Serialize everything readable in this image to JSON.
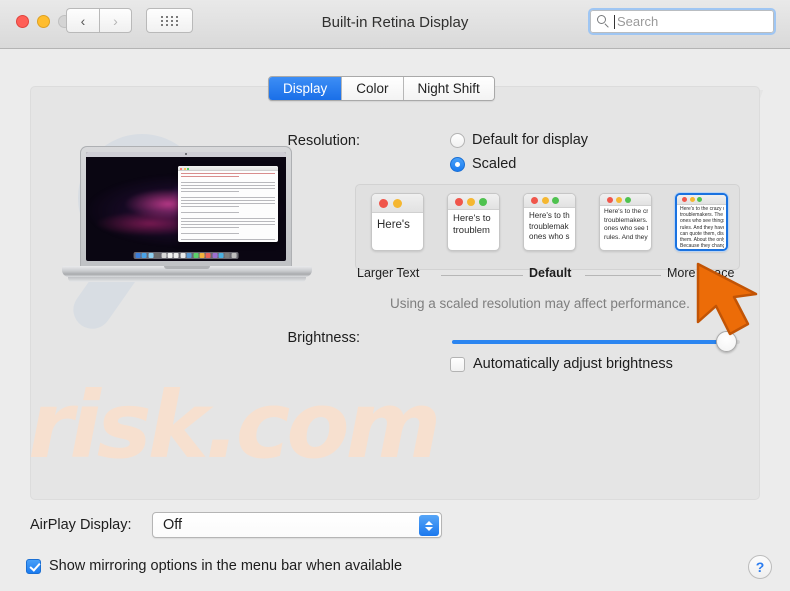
{
  "window": {
    "title": "Built-in Retina Display",
    "traffic_lights": [
      "close",
      "minimize",
      "zoom"
    ],
    "nav_back": "‹",
    "nav_forward": "›",
    "grid_button": "show-all"
  },
  "search": {
    "placeholder": "Search",
    "value": ""
  },
  "tabs": [
    {
      "label": "Display",
      "active": true
    },
    {
      "label": "Color",
      "active": false
    },
    {
      "label": "Night Shift",
      "active": false
    }
  ],
  "resolution": {
    "label": "Resolution:",
    "options": [
      {
        "label": "Default for display",
        "selected": false
      },
      {
        "label": "Scaled",
        "selected": true
      }
    ],
    "scaled_thumbnails": [
      {
        "text": "Here's",
        "selected": false
      },
      {
        "text": "Here's to\ntroublem",
        "selected": false
      },
      {
        "text": "Here's to th\ntroublemak\nones who s",
        "selected": false
      },
      {
        "text": "Here's to the cr\ntroublemakers.\nones who see t\nrules. And they",
        "selected": false
      },
      {
        "text": "Here's to the crazy one\ntroublemakers. The rou\nones who see things di\nrules. And they have no\ncan quote them, disagr\nthem. About the only th\nBecause they change th",
        "selected": true
      }
    ],
    "scale_ticks": [
      {
        "label": "Larger Text",
        "bold": false
      },
      {
        "label": "Default",
        "bold": true
      },
      {
        "label": "More Space",
        "bold": false
      }
    ],
    "hint": "Using a scaled resolution may affect performance."
  },
  "brightness": {
    "label": "Brightness:",
    "value_percent": 95,
    "auto_adjust": {
      "label": "Automatically adjust brightness",
      "checked": false
    }
  },
  "airplay": {
    "label": "AirPlay Display:",
    "value": "Off",
    "options": [
      "Off"
    ]
  },
  "mirroring": {
    "label": "Show mirroring options in the menu bar when available",
    "checked": true
  },
  "help": {
    "label": "?"
  },
  "watermark": {
    "text": "risk.com",
    "text_color": "#f7e0cf"
  },
  "annotation": {
    "arrow_color": "#ec6c08",
    "points_at": "More Space"
  },
  "colors": {
    "accent_blue": "#1a7bf0",
    "tab_active": "#2b80ef",
    "selection_border": "#1a72e0",
    "window_bg": "#ececec",
    "panel_bg": "#e5e5e5"
  },
  "macbook": {
    "doc_window_title": "",
    "dock_items": [
      "finder",
      "mail",
      "safari",
      "contacts",
      "calendar",
      "notes",
      "reminders",
      "maps",
      "photos",
      "messages",
      "facetime",
      "itunes",
      "appstore",
      "preferences",
      "trash"
    ]
  }
}
